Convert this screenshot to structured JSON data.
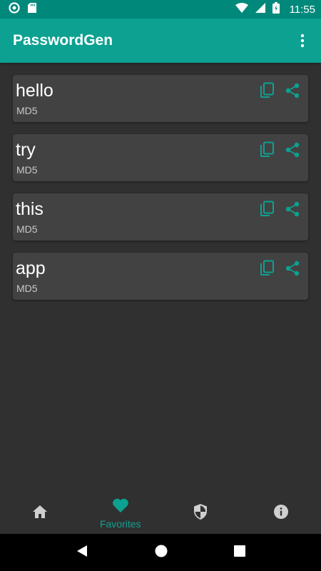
{
  "status_bar": {
    "time": "11:55",
    "icons": [
      "sync-icon",
      "sd-card-icon",
      "wifi-icon",
      "signal-icon",
      "battery-charging-icon"
    ]
  },
  "app_bar": {
    "title": "PasswordGen",
    "menu_icon": "more-vert-icon"
  },
  "colors": {
    "accent": "#0ca191",
    "status_bar": "#00897b",
    "background": "#303030",
    "card": "#424242"
  },
  "favorites": [
    {
      "name": "hello",
      "algorithm": "MD5"
    },
    {
      "name": "try",
      "algorithm": "MD5"
    },
    {
      "name": "this",
      "algorithm": "MD5"
    },
    {
      "name": "app",
      "algorithm": "MD5"
    }
  ],
  "bottom_nav": {
    "items": [
      {
        "icon": "home-icon",
        "label": ""
      },
      {
        "icon": "heart-icon",
        "label": "Favorites",
        "selected": true
      },
      {
        "icon": "shield-icon",
        "label": ""
      },
      {
        "icon": "info-icon",
        "label": ""
      }
    ]
  },
  "system_nav": {
    "icons": [
      "back-icon",
      "home-circle-icon",
      "recents-icon"
    ]
  }
}
